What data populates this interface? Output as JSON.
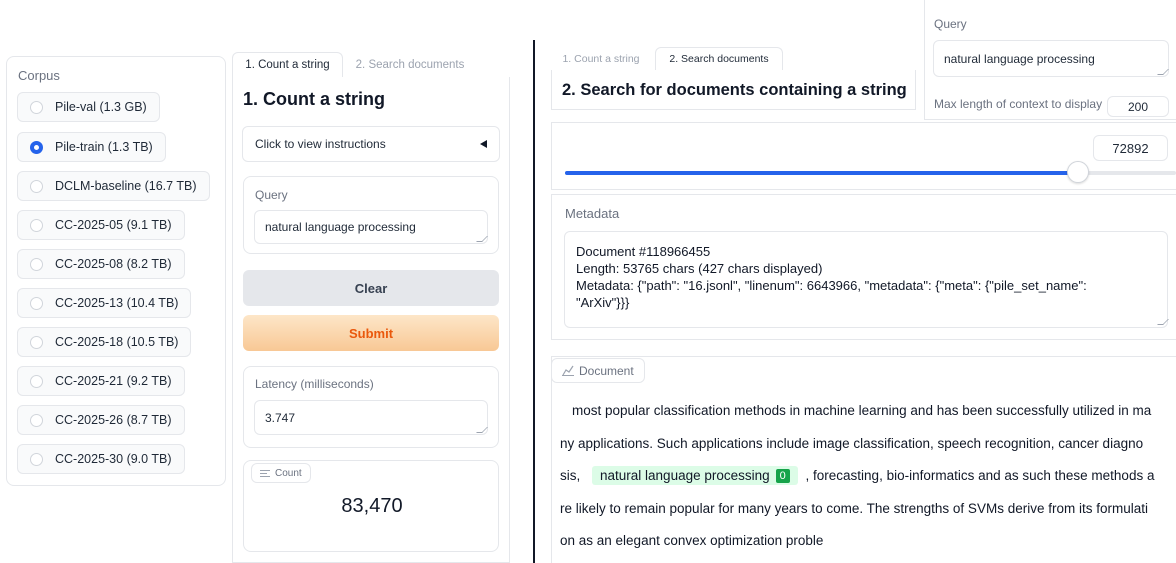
{
  "corpus": {
    "label": "Corpus",
    "options": [
      {
        "label": "Pile-val (1.3 GB)",
        "selected": false
      },
      {
        "label": "Pile-train (1.3 TB)",
        "selected": true
      },
      {
        "label": "DCLM-baseline (16.7 TB)",
        "selected": false
      },
      {
        "label": "CC-2025-05 (9.1 TB)",
        "selected": false
      },
      {
        "label": "CC-2025-08 (8.2 TB)",
        "selected": false
      },
      {
        "label": "CC-2025-13 (10.4 TB)",
        "selected": false
      },
      {
        "label": "CC-2025-18 (10.5 TB)",
        "selected": false
      },
      {
        "label": "CC-2025-21 (9.2 TB)",
        "selected": false
      },
      {
        "label": "CC-2025-26 (8.7 TB)",
        "selected": false
      },
      {
        "label": "CC-2025-30 (9.0 TB)",
        "selected": false
      }
    ]
  },
  "count_panel": {
    "tabs": [
      "1. Count a string",
      "2. Search documents"
    ],
    "active_tab": 0,
    "heading": "1. Count a string",
    "instructions_label": "Click to view instructions",
    "query_label": "Query",
    "query_value": "natural language processing",
    "clear_label": "Clear",
    "submit_label": "Submit",
    "latency_label": "Latency (milliseconds)",
    "latency_value": "3.747",
    "count_label": "Count",
    "count_value": "83,470"
  },
  "search_panel": {
    "tabs": [
      "1. Count a string",
      "2. Search documents"
    ],
    "active_tab": 1,
    "heading": "2. Search for documents containing a string",
    "query_label": "Query",
    "query_value": "natural language processing",
    "max_context_label": "Max length of context to display",
    "max_context_value": "200",
    "slider_value": "72892",
    "slider_fraction": 0.84,
    "metadata_label": "Metadata",
    "metadata_lines": [
      "Document #118966455",
      "Length: 53765 chars (427 chars displayed)",
      "Metadata: {\"path\": \"16.jsonl\", \"linenum\": 6643966, \"metadata\": {\"meta\": {\"pile_set_name\":",
      "\"ArXiv\"}}}"
    ],
    "document_label": "Document",
    "document": {
      "line1": "most popular classification methods in machine learning and has been successfully utilized in ma",
      "line2": "ny applications. Such applications include image classification, speech recognition, cancer diagno",
      "line3_pre": "sis,",
      "highlight_text": "natural language processing",
      "highlight_badge": "0",
      "line3_post": ", forecasting, bio-informatics and as such these methods a",
      "line4": "re likely to remain popular for many years to come. The strengths of SVMs derive from its formulati",
      "line5": "on as an elegant convex optimization proble"
    }
  },
  "colors": {
    "accent_blue": "#2563eb",
    "submit_text": "#ea580c",
    "highlight_bg": "#dcfce7",
    "highlight_badge": "#16a34a"
  }
}
